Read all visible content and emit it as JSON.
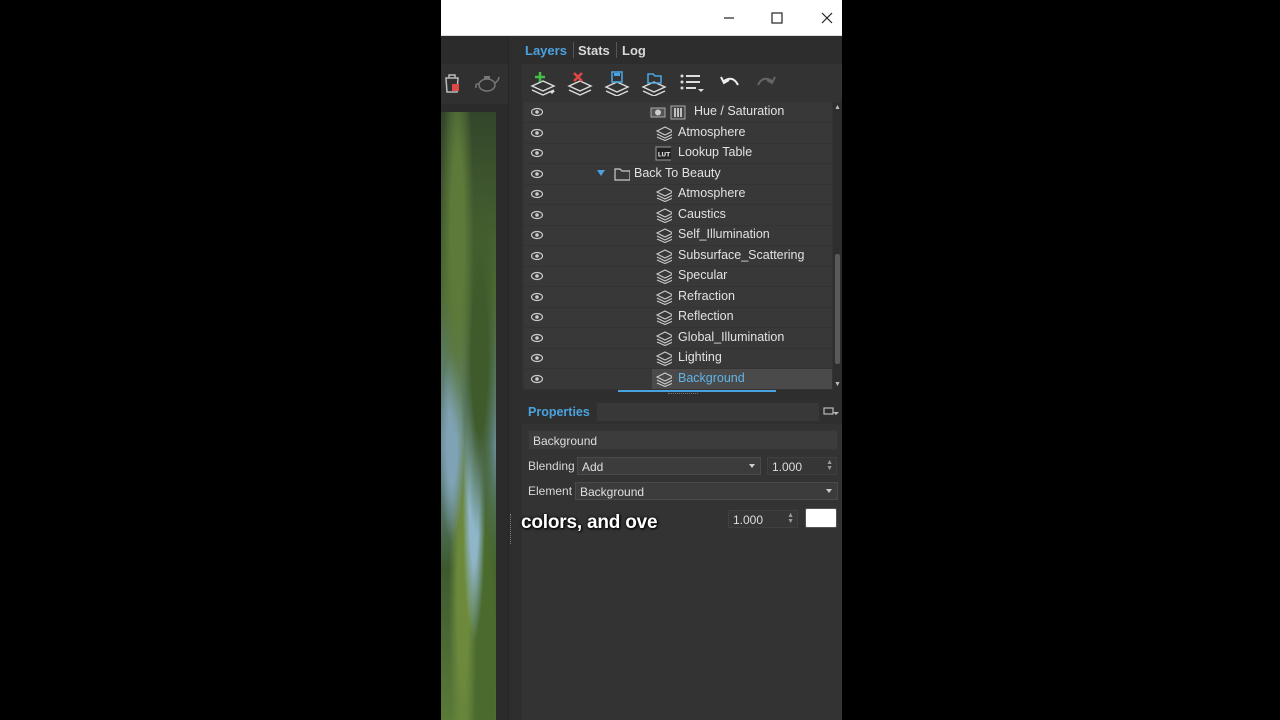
{
  "window": {
    "controls": [
      "minimize-icon",
      "maximize-icon",
      "close-icon"
    ]
  },
  "tabs": [
    {
      "label": "Layers",
      "active": true
    },
    {
      "label": "Stats",
      "active": false
    },
    {
      "label": "Log",
      "active": false
    }
  ],
  "toolbar": {
    "buttons": [
      "add-layer-icon",
      "remove-layer-icon",
      "save-layers-icon",
      "load-layers-icon",
      "list-menu-icon",
      "undo-icon",
      "redo-icon"
    ]
  },
  "layers": {
    "items": [
      {
        "label": "Hue / Saturation",
        "icon": "hue-saturation-icon",
        "indent": 2
      },
      {
        "label": "Atmosphere",
        "icon": "layer-stack-icon",
        "indent": 2
      },
      {
        "label": "Lookup Table",
        "icon": "lut-icon",
        "indent": 2
      },
      {
        "label": "Back To Beauty",
        "icon": "folder-icon",
        "indent": 1,
        "expanded": true
      },
      {
        "label": "Atmosphere",
        "icon": "layer-stack-icon",
        "indent": 2
      },
      {
        "label": "Caustics",
        "icon": "layer-stack-icon",
        "indent": 2
      },
      {
        "label": "Self_Illumination",
        "icon": "layer-stack-icon",
        "indent": 2
      },
      {
        "label": "Subsurface_Scattering",
        "icon": "layer-stack-icon",
        "indent": 2
      },
      {
        "label": "Specular",
        "icon": "layer-stack-icon",
        "indent": 2
      },
      {
        "label": "Refraction",
        "icon": "layer-stack-icon",
        "indent": 2
      },
      {
        "label": "Reflection",
        "icon": "layer-stack-icon",
        "indent": 2
      },
      {
        "label": "Global_Illumination",
        "icon": "layer-stack-icon",
        "indent": 2
      },
      {
        "label": "Lighting",
        "icon": "layer-stack-icon",
        "indent": 2
      },
      {
        "label": "Background",
        "icon": "layer-stack-icon",
        "indent": 2,
        "selected": true
      }
    ]
  },
  "properties": {
    "title": "Properties",
    "name": "Background",
    "blending_label": "Blending",
    "blending_value": "Add",
    "opacity_value": "1.000",
    "element_label": "Element",
    "element_value": "Background",
    "multiplier_value": "1.000",
    "swatch_color": "#ffffff"
  },
  "caption": "colors, and ove",
  "colors": {
    "accent": "#4aa3df",
    "panel_bg": "#333333",
    "list_bg": "#383838"
  }
}
